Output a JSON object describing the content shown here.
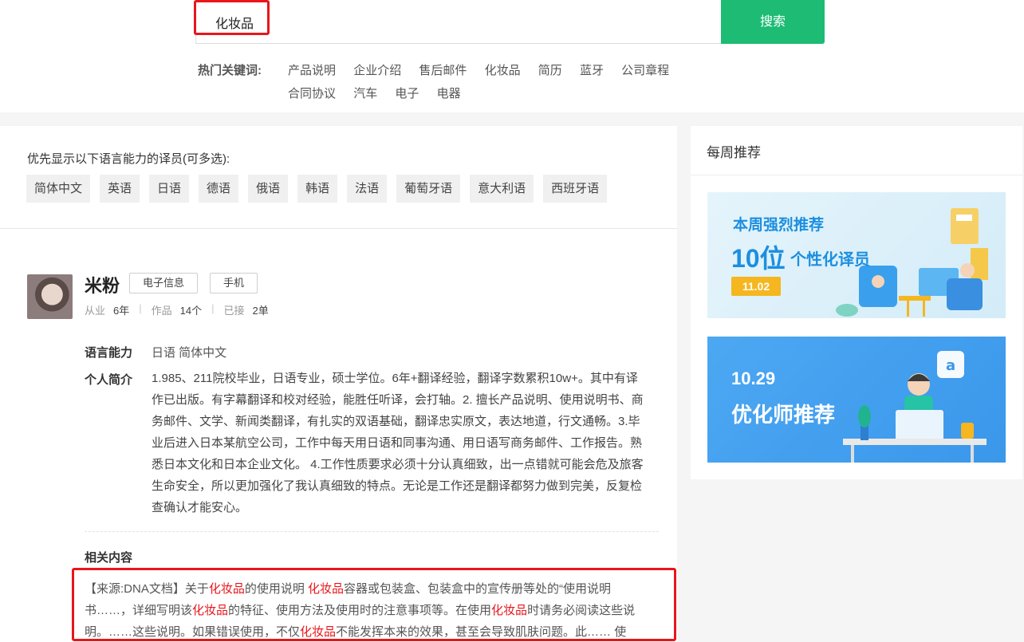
{
  "search": {
    "value": "化妆品",
    "button": "搜索"
  },
  "hot": {
    "label": "热门关键词:",
    "row1": [
      "产品说明",
      "企业介绍",
      "售后邮件",
      "化妆品",
      "简历",
      "蓝牙",
      "公司章程"
    ],
    "row2": [
      "合同协议",
      "汽车",
      "电子",
      "电器"
    ]
  },
  "filter": {
    "title": "优先显示以下语言能力的译员(可多选):",
    "languages": [
      "简体中文",
      "英语",
      "日语",
      "德语",
      "俄语",
      "韩语",
      "法语",
      "葡萄牙语",
      "意大利语",
      "西班牙语"
    ]
  },
  "translator": {
    "name": "米粉",
    "tags": [
      "电子信息",
      "手机"
    ],
    "stats": [
      {
        "label": "从业",
        "value": "6年"
      },
      {
        "label": "作品",
        "value": "14个"
      },
      {
        "label": "已接",
        "value": "2单"
      }
    ],
    "lang_label": "语言能力",
    "lang_value": "日语 简体中文",
    "intro_label": "个人简介",
    "intro": "1.985、211院校毕业，日语专业，硕士学位。6年+翻译经验，翻译字数累积10w+。其中有译作已出版。有字幕翻译和校对经验，能胜任听译，会打轴。2. 擅长产品说明、使用说明书、商务邮件、文学、新闻类翻译，有扎实的双语基础，翻译忠实原文，表达地道，行文通畅。3.毕业后进入日本某航空公司，工作中每天用日语和同事沟通、用日语写商务邮件、工作报告。熟悉日本文化和日本企业文化。 4.工作性质要求必须十分认真细致，出一点错就可能会危及旅客生命安全，所以更加强化了我认真细致的特点。无论是工作还是翻译都努力做到完美，反复检查确认才能安心。",
    "related_label": "相关内容",
    "related_segments": [
      "【来源:DNA文档】关于",
      "化妆品",
      "的使用说明 ",
      "化妆品",
      "容器或包装盒、包装盒中的宣传册等处的“使用说明书……，详细写明该",
      "化妆品",
      "的特征、使用方法及使用时的注意事项等。在使用",
      "化妆品",
      "时请务必阅读这些说明。……这些说明。如果错误使用，不仅",
      "化妆品",
      "不能发挥本来的效果，甚至会导致肌肤问题。此…… 使"
    ]
  },
  "sidebar": {
    "title": "每周推荐",
    "banner1": {
      "line1": "本周强烈推荐",
      "big": "10位",
      "sub": "个性化译员",
      "date": "11.02"
    },
    "banner2": {
      "date": "10.29",
      "title": "优化师推荐"
    }
  },
  "colors": {
    "accent": "#1dbb74",
    "highlight": "#e8161a"
  }
}
